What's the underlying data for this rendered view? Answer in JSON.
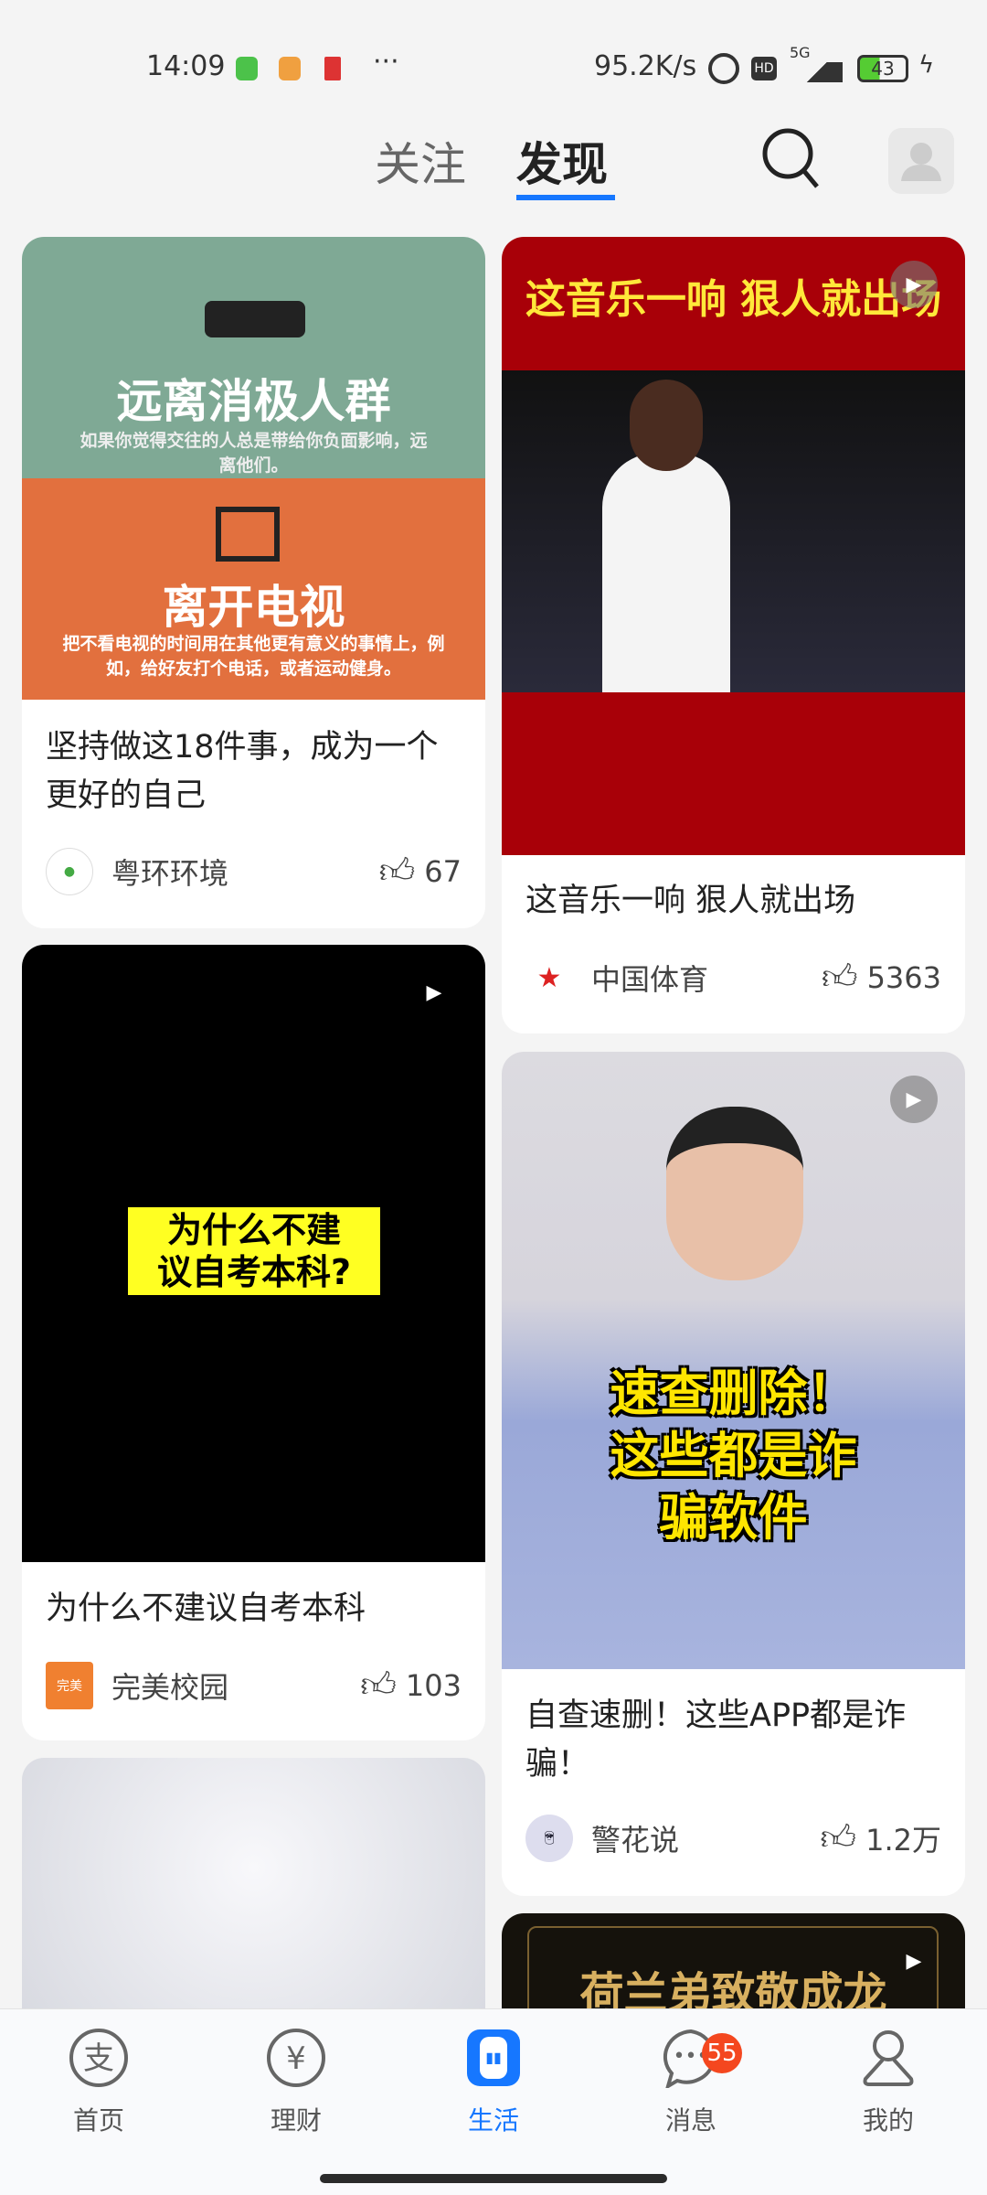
{
  "status_bar": {
    "time": "14:09",
    "more": "···",
    "net_speed": "95.2K/s",
    "network": "5G",
    "battery": "43"
  },
  "header": {
    "tabs": [
      {
        "label": "关注",
        "active": false
      },
      {
        "label": "发现",
        "active": true
      }
    ],
    "accent": "#1677ff"
  },
  "feed": {
    "left": [
      {
        "image_text": {
          "heading1": "远离消极人群",
          "sub1": "如果你觉得交往的人总是带给你负面影响，远离他们。",
          "heading2": "离开电视",
          "sub2": "把不看电视的时间用在其他更有意义的事情上，例如，给好友打个电话，或者运动健身。"
        },
        "title": "坚持做这18件事，成为一个更好的自己",
        "author": "粤环环境",
        "likes": "67",
        "video": false
      },
      {
        "image_text": {
          "caption": "为什么不建议自考本科?"
        },
        "title": "为什么不建议自考本科",
        "author": "完美校园",
        "likes": "103",
        "video": true
      },
      {
        "video": false
      }
    ],
    "right": [
      {
        "image_text": {
          "caption": "这音乐一响 狠人就出场"
        },
        "title": "这音乐一响 狠人就出场",
        "author": "中国体育",
        "likes": "5363",
        "video": true
      },
      {
        "image_text": {
          "caption": "速查删除！这些都是诈骗软件"
        },
        "title": "自查速删！这些APP都是诈骗！",
        "author": "警花说",
        "likes": "1.2万",
        "video": true
      },
      {
        "image_text": {
          "caption": "荷兰弟致敬成龙"
        },
        "video": true
      }
    ]
  },
  "bottom_nav": {
    "items": [
      {
        "label": "首页",
        "icon": "alipay-icon"
      },
      {
        "label": "理财",
        "icon": "yuan-icon"
      },
      {
        "label": "生活",
        "icon": "life-icon",
        "active": true
      },
      {
        "label": "消息",
        "icon": "message-icon",
        "badge": "55"
      },
      {
        "label": "我的",
        "icon": "user-icon"
      }
    ]
  }
}
